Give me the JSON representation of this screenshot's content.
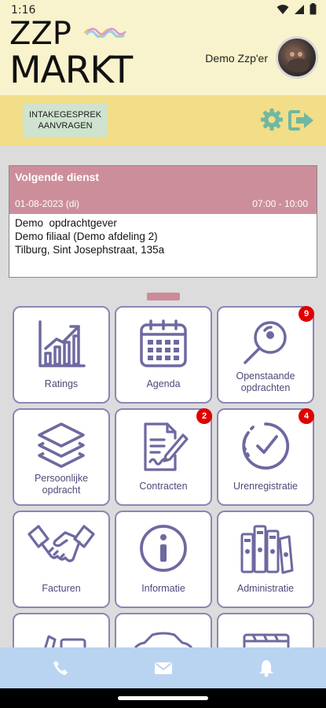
{
  "status_bar": {
    "time": "1:16",
    "icons": [
      "wifi-icon",
      "signal-icon",
      "battery-icon"
    ]
  },
  "header": {
    "logo_line1": "ZZP",
    "logo_line2": "MARKT",
    "user_name": "Demo Zzp'er"
  },
  "actions": {
    "intake_label": "INTAKEGESPREK AANVRAGEN",
    "settings_icon": "gear-icon",
    "logout_icon": "logout-icon"
  },
  "next_shift": {
    "title": "Volgende dienst",
    "date": "01-08-2023 (di)",
    "time": "07:00 - 10:00",
    "client": "Demo  opdrachtgever",
    "branch": "Demo filiaal (Demo afdeling 2)",
    "address": "Tilburg, Sint Josephstraat, 135a"
  },
  "tiles": [
    {
      "label": "Ratings",
      "icon": "chart-growth-icon",
      "badge": null
    },
    {
      "label": "Agenda",
      "icon": "calendar-icon",
      "badge": null
    },
    {
      "label": "Openstaande opdrachten",
      "icon": "magnifier-icon",
      "badge": "9"
    },
    {
      "label": "Persoonlijke opdracht",
      "icon": "layers-icon",
      "badge": null
    },
    {
      "label": "Contracten",
      "icon": "contract-pen-icon",
      "badge": "2"
    },
    {
      "label": "Urenregistratie",
      "icon": "check-circle-icon",
      "badge": "4"
    },
    {
      "label": "Facturen",
      "icon": "handshake-icon",
      "badge": null
    },
    {
      "label": "Informatie",
      "icon": "info-icon",
      "badge": null
    },
    {
      "label": "Administratie",
      "icon": "binders-icon",
      "badge": null
    }
  ],
  "bottom_nav": {
    "items": [
      "phone-icon",
      "mail-icon",
      "bell-icon"
    ]
  },
  "colors": {
    "header_bg": "#f8f3cc",
    "band_bg": "#f2dd88",
    "accent_green": "#6fb8a1",
    "card_head": "#cd8e9b",
    "tile_border": "#8b86b6",
    "bottom_nav": "#b9d4f1",
    "badge": "#e00000"
  }
}
